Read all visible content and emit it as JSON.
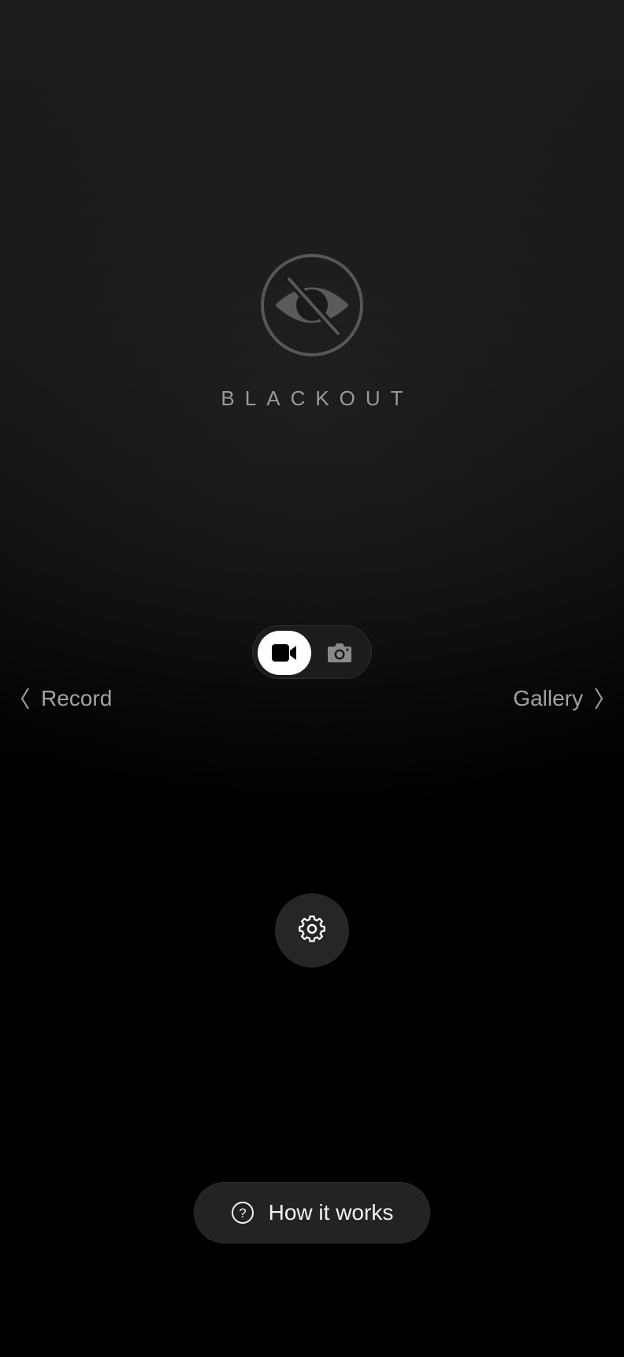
{
  "app": {
    "brand_name": "BLACKOUT",
    "logo_icon": "eye-slash-icon"
  },
  "mode_toggle": {
    "options": [
      {
        "id": "video",
        "icon": "video-camera-icon",
        "selected": true
      },
      {
        "id": "photo",
        "icon": "photo-camera-icon",
        "selected": false
      }
    ]
  },
  "navigation": {
    "left": {
      "label": "Record",
      "icon": "chevron-left-icon"
    },
    "right": {
      "label": "Gallery",
      "icon": "chevron-right-icon"
    }
  },
  "settings": {
    "icon": "gear-icon"
  },
  "help": {
    "label": "How it works",
    "icon": "question-circle-icon"
  },
  "colors": {
    "background_top": "#1d1d1d",
    "background_bottom": "#000000",
    "logo": "#5a5a5a",
    "brand_text": "#9a9a9a",
    "nav_text": "#a3a3a3",
    "toggle_selected": "#ffffff",
    "button_bg": "#262626"
  }
}
